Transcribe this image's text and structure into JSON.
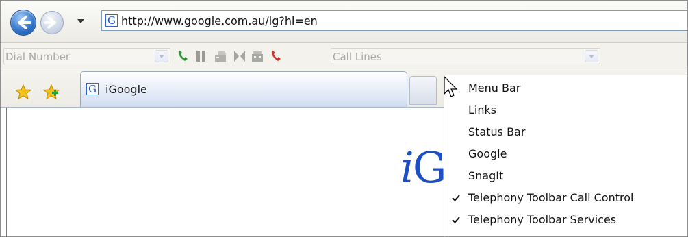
{
  "nav": {
    "address_url": "http://www.google.com.au/ig?hl=en",
    "favicon_letter": "G"
  },
  "telephony_toolbar": {
    "dial_number_placeholder": "Dial Number",
    "call_lines_placeholder": "Call Lines"
  },
  "tab_bar": {
    "active_tab_title": "iGoogle",
    "favicon_letter": "G"
  },
  "page": {
    "logo_partial_i": "i",
    "logo_partial_g": "G"
  },
  "context_menu": {
    "items": [
      {
        "label": "Menu Bar",
        "checked": false
      },
      {
        "label": "Links",
        "checked": false
      },
      {
        "label": "Status Bar",
        "checked": false
      },
      {
        "label": "Google",
        "checked": false
      },
      {
        "label": "SnagIt",
        "checked": false
      },
      {
        "label": "Telephony Toolbar Call Control",
        "checked": true
      },
      {
        "label": "Telephony Toolbar Services",
        "checked": true
      }
    ]
  },
  "colors": {
    "accent_blue": "#2d71c8",
    "phone_green": "#2e9b3b",
    "phone_red": "#d8352f"
  }
}
